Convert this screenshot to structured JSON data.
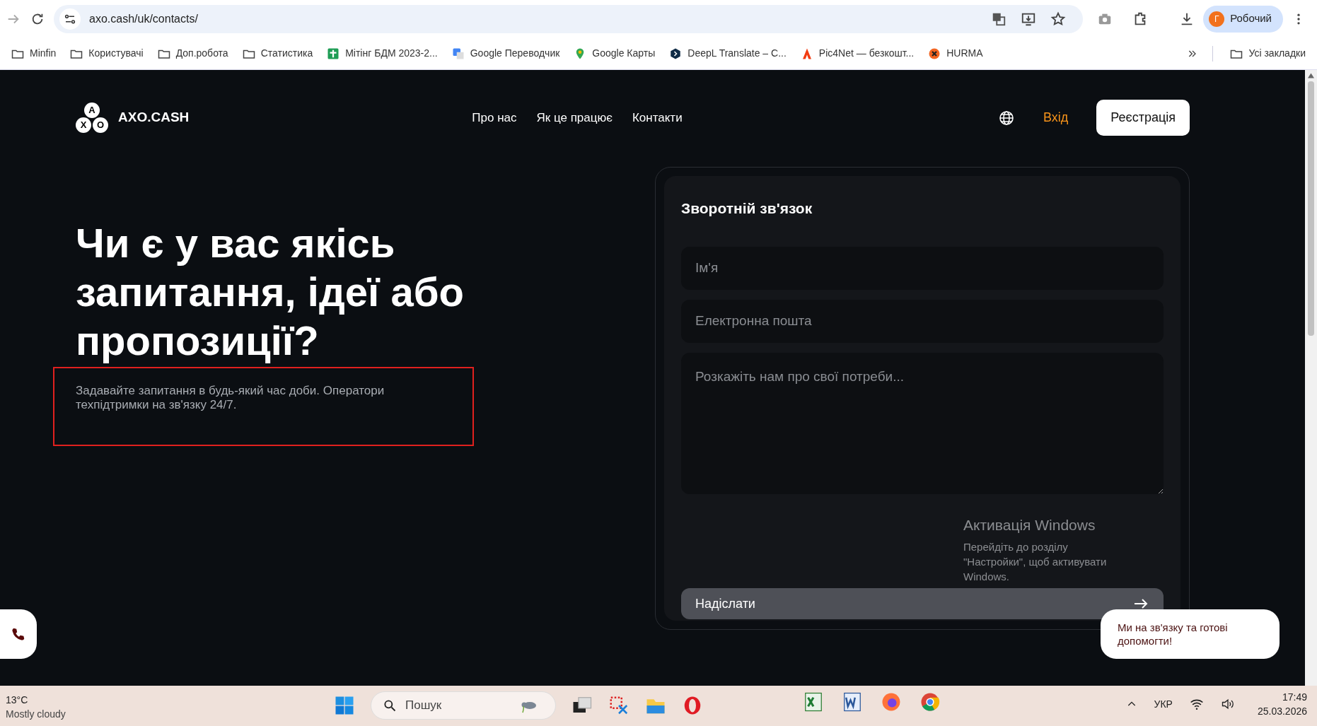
{
  "browser": {
    "url": "axo.cash/uk/contacts/",
    "profile": {
      "initial": "Г",
      "label": "Робочий"
    },
    "bookmarks": [
      {
        "kind": "folder",
        "label": "Minfin"
      },
      {
        "kind": "folder",
        "label": "Користувачі"
      },
      {
        "kind": "folder",
        "label": "Доп.робота"
      },
      {
        "kind": "folder",
        "label": "Статистика"
      },
      {
        "kind": "sheet",
        "label": "Мітінг БДМ 2023-2..."
      },
      {
        "kind": "translate",
        "label": "Google Переводчик"
      },
      {
        "kind": "maps",
        "label": "Google Карты"
      },
      {
        "kind": "deepl",
        "label": "DeepL Translate – C..."
      },
      {
        "kind": "pic",
        "label": "Pic4Net — безкошт..."
      },
      {
        "kind": "hurma",
        "label": "HURMA"
      }
    ],
    "all_bookmarks": "Усі закладки"
  },
  "site": {
    "logo": {
      "letters": [
        "A",
        "X",
        "O"
      ],
      "name": "AXO.CASH"
    },
    "nav": [
      "Про нас",
      "Як це працює",
      "Контакти"
    ],
    "login": "Вхід",
    "register": "Реєстрація",
    "heading": "Чи є у вас якісь запитання, ідеї або пропозиції?",
    "subtitle": "Задавайте запитання в будь-який час доби. Оператори техпідтримки на зв'язку 24/7.",
    "form": {
      "title": "Зворотній зв'язок",
      "fields": [
        {
          "kind": "input",
          "placeholder": "Ім'я"
        },
        {
          "kind": "input",
          "placeholder": "Електронна пошта"
        },
        {
          "kind": "textarea",
          "placeholder": "Розкажіть нам про свої потреби..."
        }
      ],
      "submit": "Надіслати"
    },
    "chat_bubble": "Ми на зв'язку та готові допомогти!"
  },
  "activation": {
    "title": "Активація Windows",
    "text": "Перейдіть до розділу \"Настройки\", щоб активувати Windows."
  },
  "taskbar": {
    "weather": {
      "temp": "13°C",
      "text": "Mostly cloudy"
    },
    "search": "Пошук",
    "language": "УКР",
    "time": "17:49",
    "date": "25.03.2026"
  }
}
